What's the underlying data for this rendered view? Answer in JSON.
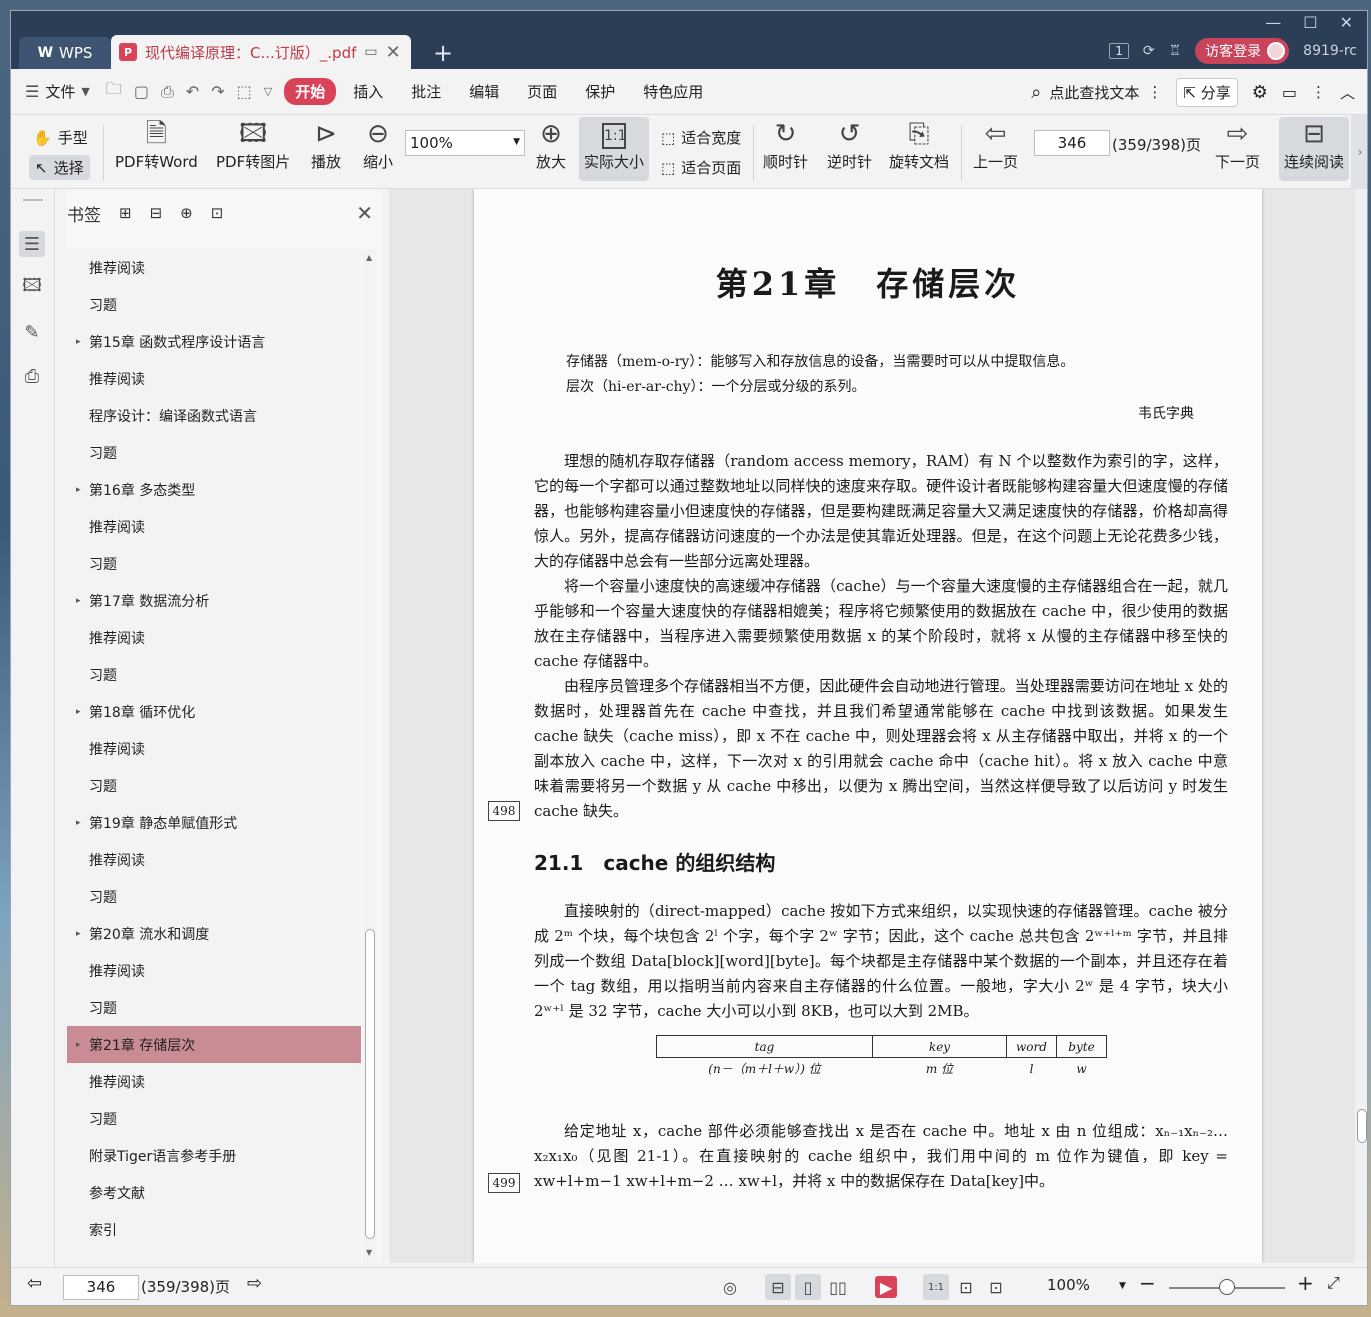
{
  "titlebar": {
    "app_tab": "WPS",
    "doc_tab": "现代编译原理：C...订版）_.pdf",
    "page_badge": "1",
    "login": "访客登录",
    "user": "8919-rc"
  },
  "menubar": {
    "file": "文件",
    "tabs": [
      "开始",
      "插入",
      "批注",
      "编辑",
      "页面",
      "保护",
      "特色应用"
    ],
    "search": "点此查找文本",
    "share": "分享"
  },
  "toolbar": {
    "hand": "手型",
    "select": "选择",
    "pdf_to_word": "PDF转Word",
    "pdf_to_image": "PDF转图片",
    "play": "播放",
    "zoom_out": "缩小",
    "zoom_value": "100%",
    "zoom_in": "放大",
    "actual_size": "实际大小",
    "fit_width": "适合宽度",
    "fit_page": "适合页面",
    "clockwise": "顺时针",
    "counterclockwise": "逆时针",
    "rotate_doc": "旋转文档",
    "prev_page": "上一页",
    "page_number": "346",
    "page_total": "(359/398)页",
    "next_page": "下一页",
    "continuous": "连续阅读"
  },
  "bookmarks": {
    "title": "书签",
    "items": [
      {
        "label": "推荐阅读",
        "chapter": false,
        "selected": false
      },
      {
        "label": "习题",
        "chapter": false,
        "selected": false
      },
      {
        "label": "第15章 函数式程序设计语言",
        "chapter": true,
        "selected": false
      },
      {
        "label": "推荐阅读",
        "chapter": false,
        "selected": false
      },
      {
        "label": "程序设计：编译函数式语言",
        "chapter": false,
        "selected": false
      },
      {
        "label": "习题",
        "chapter": false,
        "selected": false
      },
      {
        "label": "第16章 多态类型",
        "chapter": true,
        "selected": false
      },
      {
        "label": "推荐阅读",
        "chapter": false,
        "selected": false
      },
      {
        "label": "习题",
        "chapter": false,
        "selected": false
      },
      {
        "label": "第17章 数据流分析",
        "chapter": true,
        "selected": false
      },
      {
        "label": "推荐阅读",
        "chapter": false,
        "selected": false
      },
      {
        "label": "习题",
        "chapter": false,
        "selected": false
      },
      {
        "label": "第18章 循环优化",
        "chapter": true,
        "selected": false
      },
      {
        "label": "推荐阅读",
        "chapter": false,
        "selected": false
      },
      {
        "label": "习题",
        "chapter": false,
        "selected": false
      },
      {
        "label": "第19章 静态单赋值形式",
        "chapter": true,
        "selected": false
      },
      {
        "label": "推荐阅读",
        "chapter": false,
        "selected": false
      },
      {
        "label": "习题",
        "chapter": false,
        "selected": false
      },
      {
        "label": "第20章 流水和调度",
        "chapter": true,
        "selected": false
      },
      {
        "label": "推荐阅读",
        "chapter": false,
        "selected": false
      },
      {
        "label": "习题",
        "chapter": false,
        "selected": false
      },
      {
        "label": "第21章 存储层次",
        "chapter": true,
        "selected": true
      },
      {
        "label": "推荐阅读",
        "chapter": false,
        "selected": false
      },
      {
        "label": "习题",
        "chapter": false,
        "selected": false
      },
      {
        "label": "附录Tiger语言参考手册",
        "chapter": false,
        "selected": false
      },
      {
        "label": "参考文献",
        "chapter": false,
        "selected": false
      },
      {
        "label": "索引",
        "chapter": false,
        "selected": false
      }
    ]
  },
  "document": {
    "chapter_title": "第21章　存储层次",
    "def1": "存储器（mem-o-ry）：能够写入和存放信息的设备，当需要时可以从中提取信息。",
    "def2": "层次（hi-er-ar-chy）：一个分层或分级的系列。",
    "def_source": "韦氏字典",
    "para1": "理想的随机存取存储器（random access memory，RAM）有 N 个以整数作为索引的字，这样，它的每一个字都可以通过整数地址以同样快的速度来存取。硬件设计者既能够构建容量大但速度慢的存储器，也能够构建容量小但速度快的存储器，但是要构建既满足容量大又满足速度快的存储器，价格却高得惊人。另外，提高存储器访问速度的一个办法是使其靠近处理器。但是，在这个问题上无论花费多少钱，大的存储器中总会有一些部分远离处理器。",
    "para2": "将一个容量小速度快的高速缓冲存储器（cache）与一个容量大速度慢的主存储器组合在一起，就几乎能够和一个容量大速度快的存储器相媲美；程序将它频繁使用的数据放在 cache 中，很少使用的数据放在主存储器中，当程序进入需要频繁使用数据 x 的某个阶段时，就将 x 从慢的主存储器中移至快的 cache 存储器中。",
    "para3": "由程序员管理多个存储器相当不方便，因此硬件会自动地进行管理。当处理器需要访问在地址 x 处的数据时，处理器首先在 cache 中查找，并且我们希望通常能够在 cache 中找到该数据。如果发生 cache 缺失（cache miss），即 x 不在 cache 中，则处理器会将 x 从主存储器中取出，并将 x 的一个副本放入 cache 中，这样，下一次对 x 的引用就会 cache 命中（cache hit）。将 x 放入 cache 中意味着需要将另一个数据 y 从 cache 中移出，以便为 x 腾出空间，当然这样便导致了以后访问 y 时发生 cache 缺失。",
    "page_mark_1": "498",
    "section_title": "21.1　cache 的组织结构",
    "para4": "直接映射的（direct-mapped）cache 按如下方式来组织，以实现快速的存储器管理。cache 被分成 2ᵐ 个块，每个块包含 2ˡ 个字，每个字 2ʷ 字节；因此，这个 cache 总共包含 2ʷ⁺ˡ⁺ᵐ 字节，并且排列成一个数组 Data[block][word][byte]。每个块都是主存储器中某个数据的一个副本，并且还存在着一个 tag 数组，用以指明当前内容来自主存储器的什么位置。一般地，字大小 2ʷ 是 4 字节，块大小 2ʷ⁺ˡ 是 32 字节，cache 大小可以小到 8KB，也可以大到 2MB。",
    "diagram": {
      "fields": [
        "tag",
        "key",
        "word",
        "byte"
      ],
      "widths": [
        "(n－（m＋l＋w）) 位",
        "m 位",
        "l",
        "w"
      ]
    },
    "para5": "给定地址 x，cache 部件必须能够查找出 x 是否在 cache 中。地址 x 由 n 位组成：xₙ₋₁xₙ₋₂…x₂x₁x₀（见图 21-1）。在直接映射的 cache 组织中，我们用中间的 m 位作为键值，即 key = xw+l+m−1 xw+l+m−2 … xw+l，并将 x 中的数据保存在 Data[key]中。",
    "page_mark_2": "499"
  },
  "statusbar": {
    "page_number": "346",
    "page_total": "(359/398)页",
    "zoom": "100%"
  }
}
